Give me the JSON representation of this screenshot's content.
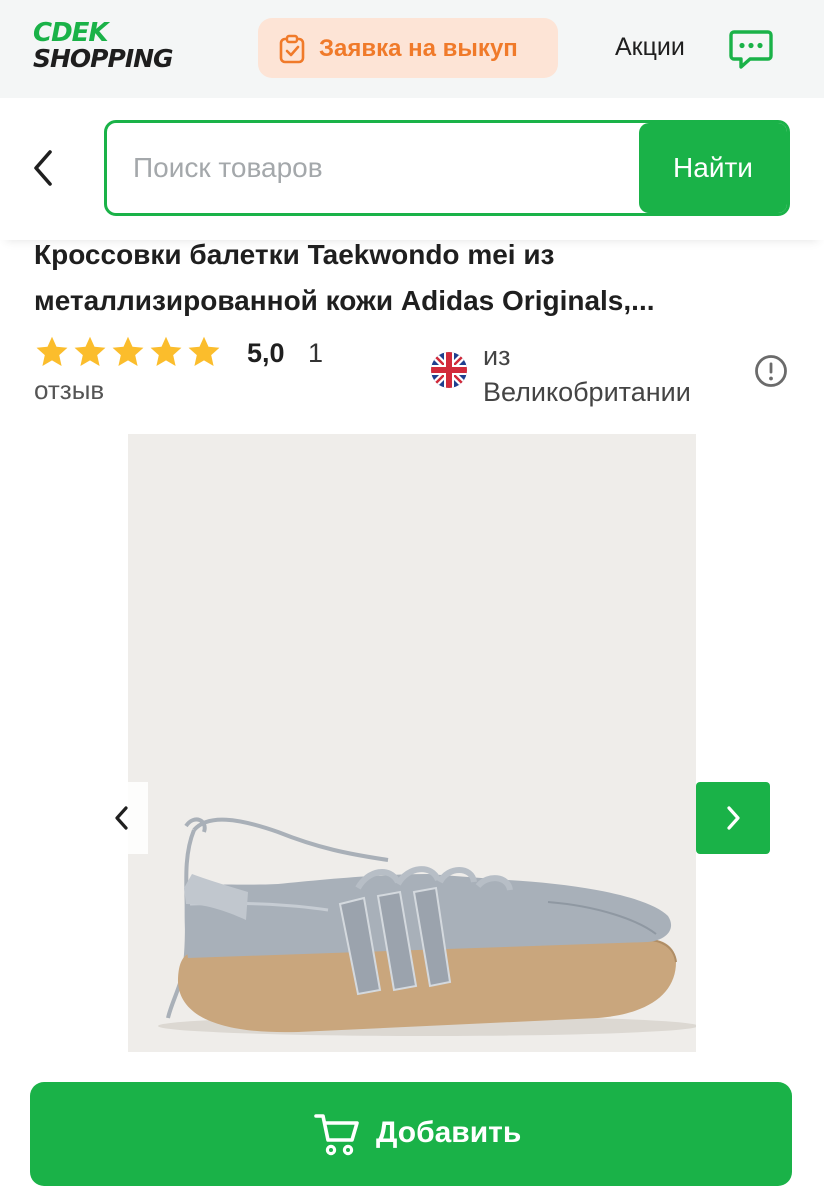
{
  "header": {
    "logo_line1": "CDEK",
    "logo_line2": "SHOPPING",
    "buyout_label": "Заявка на выкуп",
    "promos_label": "Акции",
    "brand_color": "#1ab248",
    "accent_color": "#f07a2a"
  },
  "search": {
    "placeholder": "Поиск товаров",
    "value": "",
    "button_label": "Найти"
  },
  "product": {
    "title": "Кроссовки балетки Taekwondo mei из металлизированной кожи Adidas Originals,...",
    "rating": "5,0",
    "stars_filled": 5,
    "reviews_count": "1",
    "reviews_word": "отзыв",
    "origin_prefix": "из",
    "origin_country": "Великобритании"
  },
  "gallery": {
    "image_alt": "Серые кожаные балетки с тремя полосками",
    "prev_icon": "chevron-left-icon",
    "next_icon": "chevron-right-icon"
  },
  "cart": {
    "add_label": "Добавить",
    "icon": "cart-icon"
  }
}
